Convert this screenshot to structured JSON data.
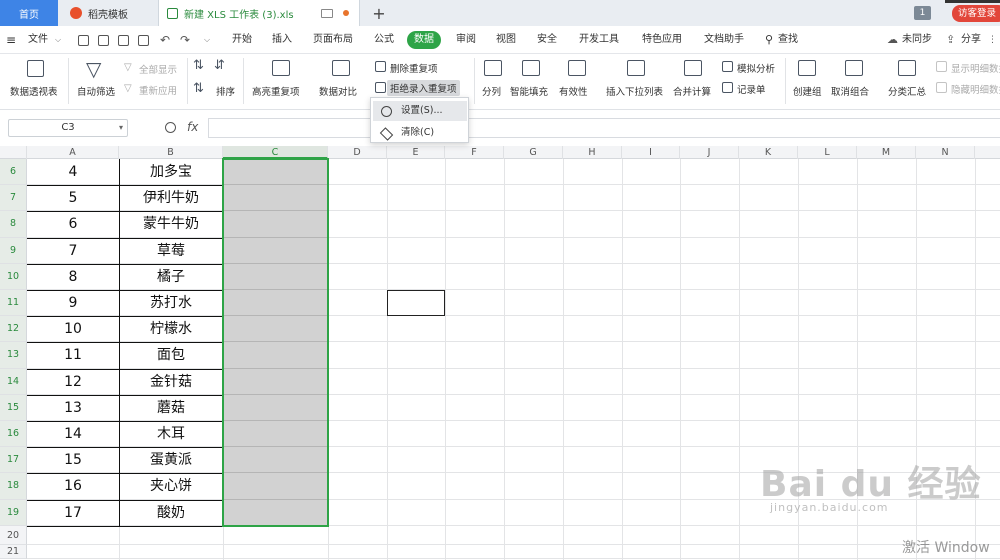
{
  "tabs": {
    "home": "首页",
    "docer": "稻壳模板",
    "file": "新建 XLS 工作表 (3).xls",
    "plus": "+"
  },
  "titlebar": {
    "badge": "1",
    "visit_label": "访客登录"
  },
  "menu": {
    "file": "文件",
    "items": [
      "开始",
      "插入",
      "页面布局",
      "公式",
      "数据",
      "审阅",
      "视图",
      "安全",
      "开发工具",
      "特色应用",
      "文档助手"
    ],
    "active": "数据",
    "search": "查找",
    "sync": "未同步",
    "share": "分享"
  },
  "ribbon": {
    "pivot": "数据透视表",
    "autofilter": "自动筛选",
    "showall": "全部显示",
    "reapply": "重新应用",
    "sort": "排序",
    "highlight_dup": "高亮重复项",
    "compare": "数据对比",
    "remove_dup": "删除重复项",
    "reject_dup": "拒绝录入重复项",
    "split": "分列",
    "smartfill": "智能填充",
    "validity": "有效性",
    "dropdown_list": "插入下拉列表",
    "consolidate": "合并计算",
    "simulate": "模拟分析",
    "record": "记录单",
    "group": "创建组",
    "ungroup": "取消组合",
    "subtotal": "分类汇总",
    "show_detail": "显示明细数据",
    "hide_detail": "隐藏明细数据"
  },
  "dropdown": {
    "settings": "设置(S)...",
    "clear": "清除(C)"
  },
  "formula": {
    "name_box": "C3",
    "fx": "fx",
    "value": ""
  },
  "columns": [
    "A",
    "B",
    "C",
    "D",
    "E",
    "F",
    "G",
    "H",
    "I",
    "J",
    "K",
    "L",
    "M",
    "N"
  ],
  "rows": [
    {
      "num": "6",
      "a": "4",
      "b": "加多宝"
    },
    {
      "num": "7",
      "a": "5",
      "b": "伊利牛奶"
    },
    {
      "num": "8",
      "a": "6",
      "b": "蒙牛牛奶"
    },
    {
      "num": "9",
      "a": "7",
      "b": "草莓"
    },
    {
      "num": "10",
      "a": "8",
      "b": "橘子"
    },
    {
      "num": "11",
      "a": "9",
      "b": "苏打水"
    },
    {
      "num": "12",
      "a": "10",
      "b": "柠檬水"
    },
    {
      "num": "13",
      "a": "11",
      "b": "面包"
    },
    {
      "num": "14",
      "a": "12",
      "b": "金针菇"
    },
    {
      "num": "15",
      "a": "13",
      "b": "蘑菇"
    },
    {
      "num": "16",
      "a": "14",
      "b": "木耳"
    },
    {
      "num": "17",
      "a": "15",
      "b": "蛋黄派"
    },
    {
      "num": "18",
      "a": "16",
      "b": "夹心饼"
    },
    {
      "num": "19",
      "a": "17",
      "b": "酸奶"
    }
  ],
  "extra_rows": [
    "20",
    "21"
  ],
  "watermark": {
    "logo": "Bai du 经验",
    "sub": "jingyan.baidu.com",
    "activate": "激活 Window"
  },
  "colors": {
    "accent": "#2ea447",
    "home_tab": "#3e84e6",
    "visit": "#e2463a"
  }
}
